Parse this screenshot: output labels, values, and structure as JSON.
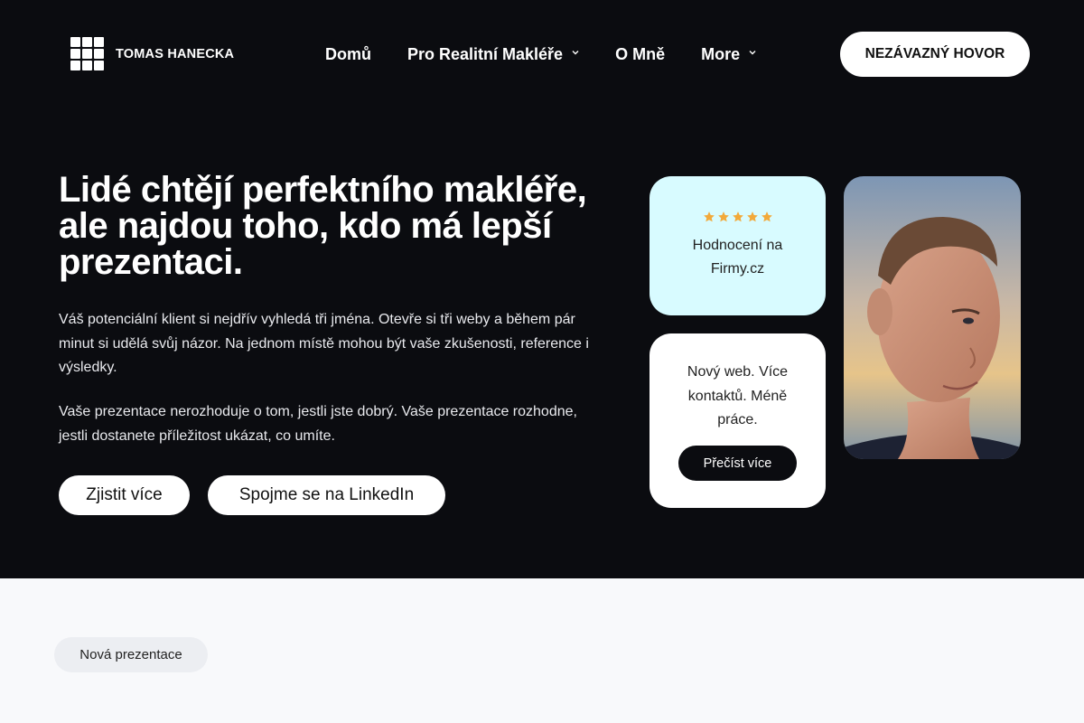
{
  "brand": {
    "name": "TOMAS HANECKA",
    "logo_icon": "grid-3x3-icon"
  },
  "nav": {
    "items": [
      {
        "label": "Domů",
        "has_dropdown": false
      },
      {
        "label": "Pro Realitní Makléře",
        "has_dropdown": true
      },
      {
        "label": "O Mně",
        "has_dropdown": false
      },
      {
        "label": "More",
        "has_dropdown": true
      }
    ],
    "cta_label": "NEZÁVAZNÝ HOVOR"
  },
  "hero": {
    "headline": "Lidé chtějí perfektního makléře, ale najdou toho, kdo má lepší prezentaci.",
    "paragraph_1": "Váš potenciální klient si nejdřív vyhledá tři jména. Otevře si tři weby a během pár minut si udělá svůj názor. Na jednom místě mohou být vaše zkušenosti, reference i výsledky.",
    "paragraph_2": "Vaše prezentace nerozhoduje o tom, jestli jste dobrý.  Vaše prezentace rozhodne, jestli dostanete příležitost ukázat, co umíte.",
    "button_more": "Zjistit více",
    "button_linkedin": "Spojme se na LinkedIn"
  },
  "rating_card": {
    "stars": 5,
    "label": "Hodnocení na Firmy.cz",
    "star_color": "#f2a93b"
  },
  "web_card": {
    "text": "Nový web. Více kontaktů. Méně práce.",
    "button": "Přečíst více"
  },
  "section_tag": "Nová prezentace",
  "colors": {
    "hero_bg": "#0b0c10",
    "rating_card_bg": "#d8fbff",
    "page_bg": "#f8f9fb"
  }
}
